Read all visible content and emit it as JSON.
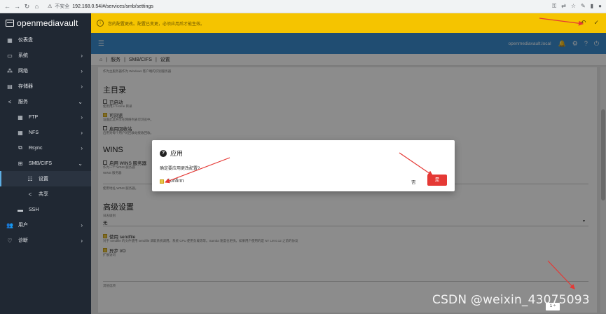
{
  "browser": {
    "insecure": "不安全",
    "url": "192.168.0.54/#/services/smb/settings"
  },
  "brand": "openmediavault",
  "nav": [
    {
      "label": "仪表盘"
    },
    {
      "label": "系统"
    },
    {
      "label": "网络"
    },
    {
      "label": "存储器"
    },
    {
      "label": "服务"
    },
    {
      "label": "FTP"
    },
    {
      "label": "NFS"
    },
    {
      "label": "Rsync"
    },
    {
      "label": "SMB/CIFS"
    },
    {
      "label": "设置"
    },
    {
      "label": "共享"
    },
    {
      "label": "SSH"
    },
    {
      "label": "用户"
    },
    {
      "label": "诊断"
    }
  ],
  "notice": {
    "text": "您的配置更改。配置已变更，必须应用后才能生效。"
  },
  "appbar": {
    "host": "openmediavault.local"
  },
  "breadcrumb": [
    "服务",
    "SMB/CIFS",
    "设置"
  ],
  "settings": {
    "intro": "作为主服务器作为 Windows 客户端的识别服务器",
    "home_title": "主目录",
    "enabled_label": "已启动",
    "enabled_hint": "使用用户 Home 目录",
    "browsable_label": "可浏览",
    "browsable_hint": "设置此此共享在网络列表可浏览中。",
    "recycle_label": "启用回收站",
    "recycle_hint": "启用对每个用户的回收站接收回收。",
    "wins_title": "WINS",
    "wins_label": "启用 WINS 服务器",
    "wins_hint1": "作为一个 WINS 服务器",
    "wins_hint2": "WINS 服务器",
    "wins_hint3": "使用地址 WINS 服务器。",
    "advanced_title": "高级设置",
    "log_label": "日志级别",
    "log_value": "无",
    "sendfile_label": "使用 sendfile",
    "sendfile_hint": "对于 sendfile 的文件使用 sendfile 调取系统调用。系统 CPU 使用负载等等。Samba 速度也更快。如果用户使用的是 NT LM 0.12 之前的协议",
    "aio_label": "异步 I/O",
    "aio_hint": "扩展访问",
    "extra_label": "其他选项"
  },
  "dialog": {
    "title": "应用",
    "message": "确定要应用更改配置?",
    "confirm_label": "Confirm",
    "no_label": "否",
    "yes_label": "是"
  },
  "watermark": "CSDN @weixin_43075093",
  "pager": "1 ÷"
}
